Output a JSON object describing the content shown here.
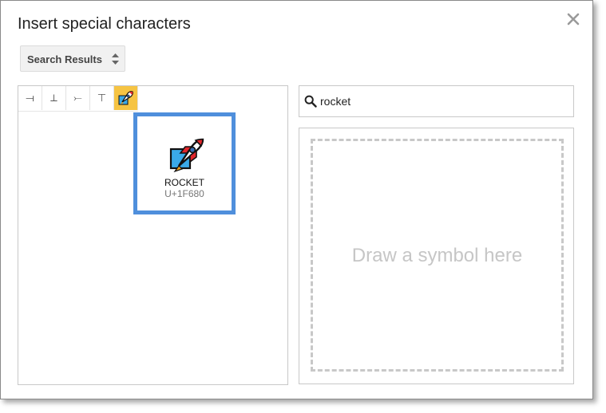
{
  "dialog": {
    "title": "Insert special characters"
  },
  "category_dropdown": {
    "selected": "Search Results"
  },
  "recent_characters": [
    {
      "glyph": "⟞",
      "active": false
    },
    {
      "glyph": "⟂",
      "active": false
    },
    {
      "glyph": "⤚",
      "active": false
    },
    {
      "glyph": "⊤",
      "active": false
    },
    {
      "glyph": "rocket-emoji",
      "active": true
    }
  ],
  "result": {
    "name": "ROCKET",
    "code": "U+1F680"
  },
  "search": {
    "value": "rocket"
  },
  "draw": {
    "hint": "Draw a symbol here"
  },
  "colors": {
    "selected_border": "#4f8fdc",
    "recent_active_bg": "#f6c443"
  }
}
